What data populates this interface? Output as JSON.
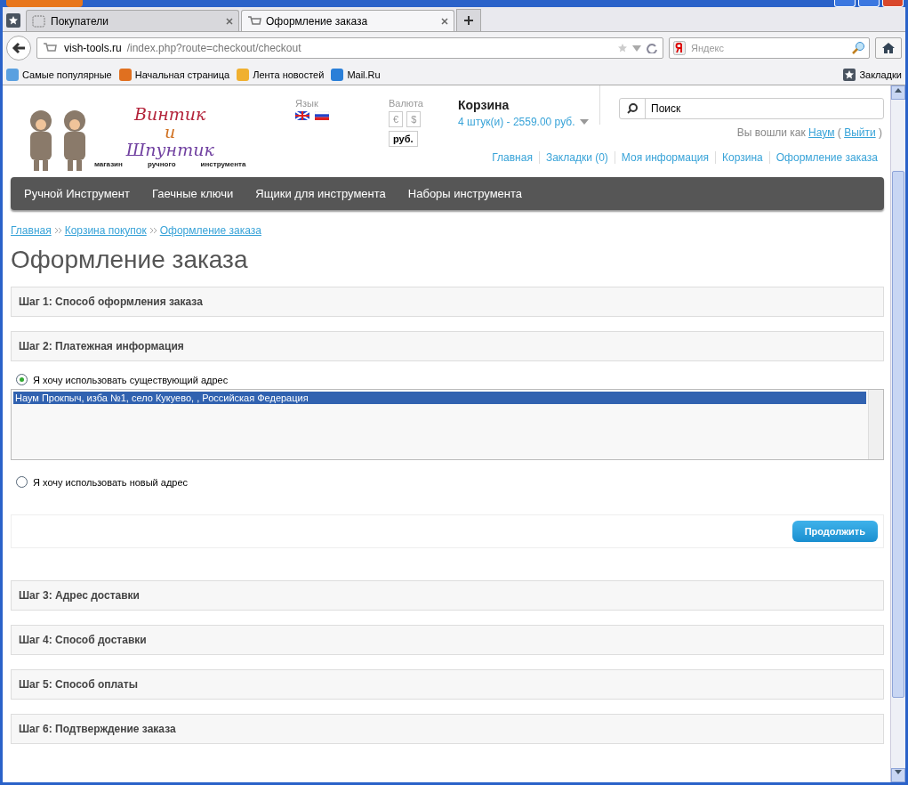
{
  "browser": {
    "tabs": [
      {
        "label": "Покупатели",
        "selected": false
      },
      {
        "label": "Оформление заказа",
        "selected": true
      }
    ],
    "url": {
      "host": "vish-tools.ru",
      "path": "/index.php?route=checkout/checkout"
    },
    "search_placeholder": "Яндекс",
    "bookmarks": [
      "Самые популярные",
      "Начальная страница",
      "Лента новостей",
      "Mail.Ru"
    ],
    "bookmarks_menu": "Закладки"
  },
  "header": {
    "logo": {
      "line1": "Винтик",
      "line2": "и",
      "line3": "Шпунтик",
      "captions": [
        "магазин",
        "ручного",
        "инструмента"
      ]
    },
    "language_label": "Язык",
    "currency_label": "Валюта",
    "currencies": [
      {
        "label": "€",
        "selected": false
      },
      {
        "label": "$",
        "selected": false
      },
      {
        "label": "руб.",
        "selected": true
      }
    ],
    "cart_title": "Корзина",
    "cart_summary": "4 штук(и) - 2559.00 руб.",
    "search_placeholder": "Поиск",
    "login_prefix": "Вы вошли как",
    "user": "Наум",
    "paren_open": "(",
    "logout": "Выйти",
    "paren_close": ")",
    "links": [
      "Главная",
      "Закладки (0)",
      "Моя информация",
      "Корзина",
      "Оформление заказа"
    ]
  },
  "menu": [
    "Ручной Инструмент",
    "Гаечные ключи",
    "Ящики для инструмента",
    "Наборы инструмента"
  ],
  "breadcrumbs": [
    "Главная",
    "Корзина покупок",
    "Оформление заказа"
  ],
  "heading": "Оформление заказа",
  "steps_before": [
    "Шаг 1: Способ оформления заказа",
    "Шаг 2: Платежная информация"
  ],
  "address_options": [
    {
      "label": "Я хочу использовать существующий адрес",
      "selected": true
    },
    {
      "label": "Я хочу использовать новый адрес",
      "selected": false
    }
  ],
  "addresses": [
    {
      "label": "Наум Прокпыч, изба №1, село Кукуево, , Российская Федерация",
      "selected": true
    }
  ],
  "continue": "Продолжить",
  "steps_after": [
    "Шаг 3: Адрес доставки",
    "Шаг 4: Способ доставки",
    "Шаг 5: Способ оплаты",
    "Шаг 6: Подтверждение заказа"
  ]
}
